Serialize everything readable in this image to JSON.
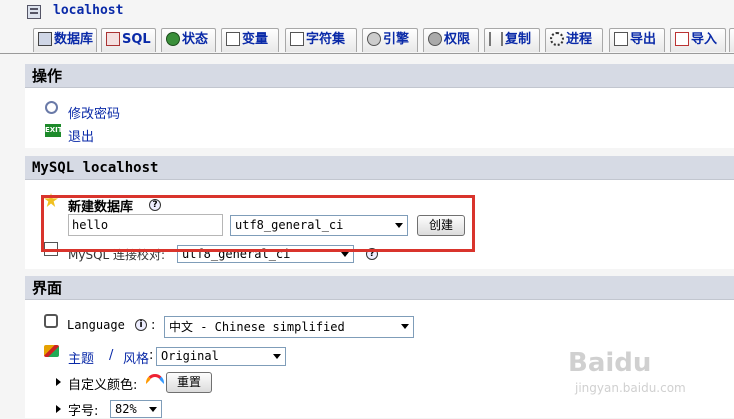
{
  "server": {
    "name": "localhost"
  },
  "tabs": [
    {
      "label": "数据库",
      "icon": "database-icon"
    },
    {
      "label": "SQL",
      "icon": "sql-icon"
    },
    {
      "label": "状态",
      "icon": "status-icon"
    },
    {
      "label": "变量",
      "icon": "variables-icon"
    },
    {
      "label": "字符集",
      "icon": "charset-icon"
    },
    {
      "label": "引擎",
      "icon": "engine-icon"
    },
    {
      "label": "权限",
      "icon": "privileges-icon"
    },
    {
      "label": "复制",
      "icon": "replication-icon"
    },
    {
      "label": "进程",
      "icon": "process-icon"
    },
    {
      "label": "导出",
      "icon": "export-icon"
    },
    {
      "label": "导入",
      "icon": "import-icon"
    }
  ],
  "actions": {
    "title": "操作",
    "change_password": "修改密码",
    "logout": "退出",
    "exit_icon_text": "EXIT"
  },
  "mysql": {
    "title": "MySQL localhost",
    "create_db_label": "新建数据库",
    "db_name_value": "hello",
    "collation_value": "utf8_general_ci",
    "create_button": "创建",
    "connection_collation_label": "MySQL 连接校对:",
    "connection_collation_value": "utf8_general_ci"
  },
  "interface": {
    "title": "界面",
    "language_label": "Language",
    "language_value": "中文 - Chinese simplified",
    "theme_label": "主题",
    "style_label": "风格",
    "theme_sep": "/",
    "theme_value": "Original",
    "custom_color_label": "自定义颜色:",
    "reset_button": "重置",
    "font_size_label": "字号:",
    "font_size_value": "82%"
  },
  "watermark": {
    "brand": "Baidu",
    "sub": "jingyan.baidu.com"
  }
}
